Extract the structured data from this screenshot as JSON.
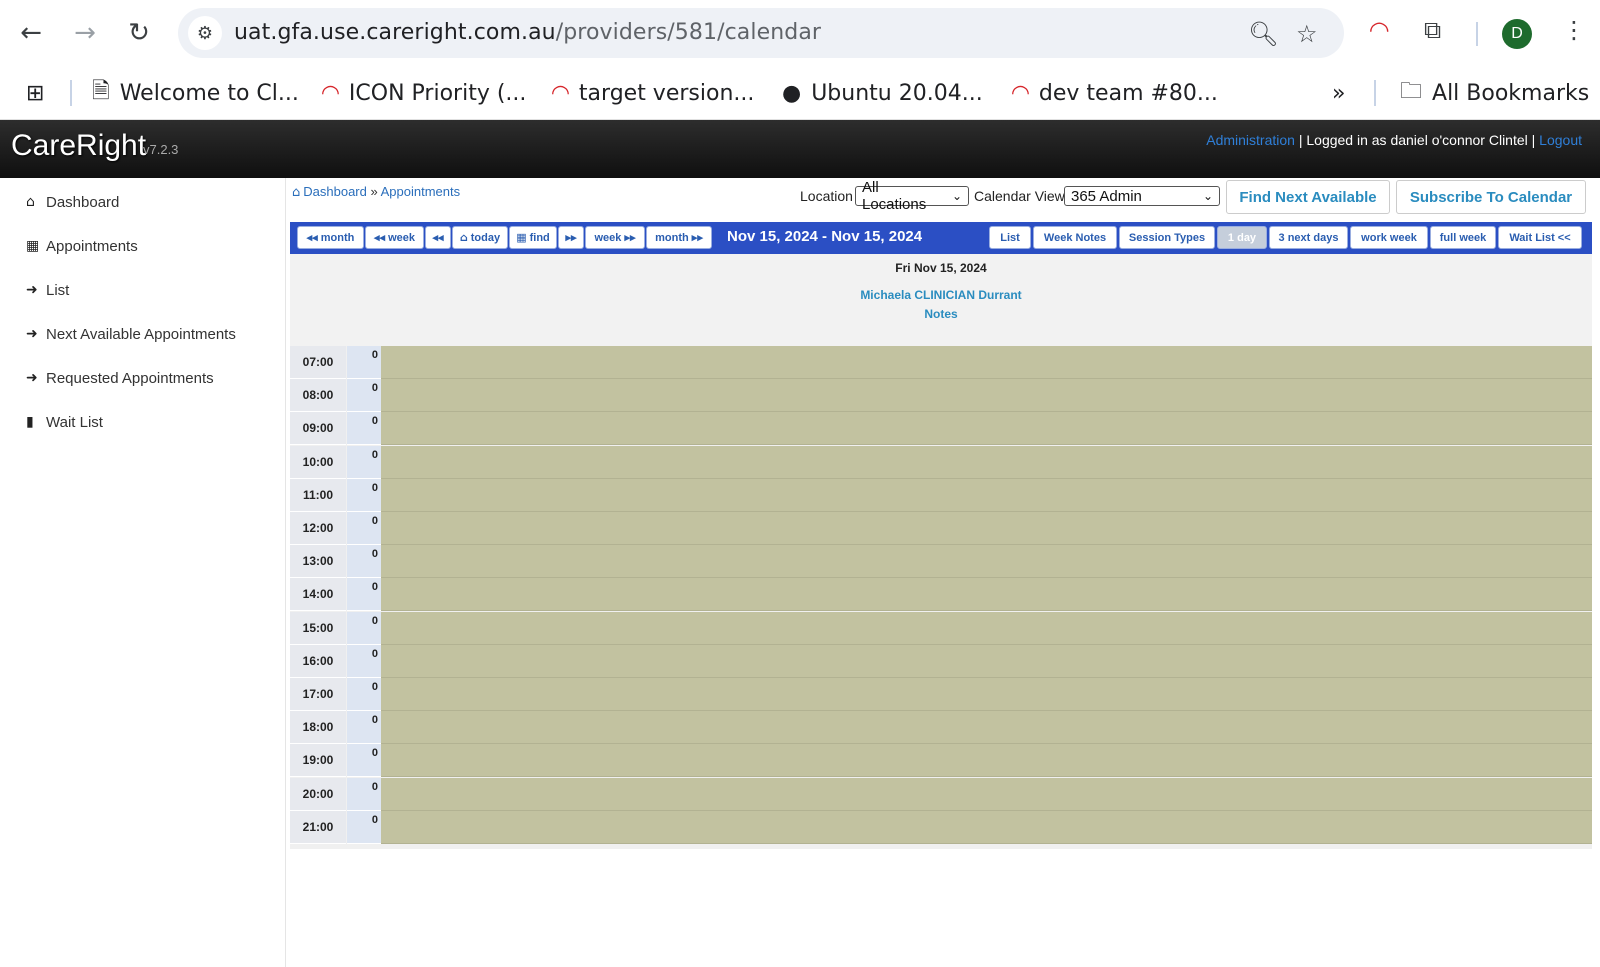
{
  "browser": {
    "url_host": "uat.gfa.use.careright.com.au",
    "url_path": "/providers/581/calendar",
    "avatar_letter": "D",
    "bookmarks": [
      {
        "label": "Welcome to Cl...",
        "icon": "document-icon"
      },
      {
        "label": "ICON Priority (...",
        "icon": "arc-logo-icon"
      },
      {
        "label": "target version...",
        "icon": "arc-logo-icon"
      },
      {
        "label": "Ubuntu 20.04...",
        "icon": "penguin-icon"
      },
      {
        "label": "dev team #80...",
        "icon": "arc-logo-icon"
      }
    ],
    "all_bookmarks_label": "All Bookmarks"
  },
  "app": {
    "brand": "CareRight",
    "version": "v7.2.3",
    "admin_link": "Administration",
    "logged_in_text": " | Logged in as daniel o'connor Clintel | ",
    "logout_link": "Logout"
  },
  "sidebar": {
    "items": [
      {
        "label": "Dashboard",
        "icon": "home-icon"
      },
      {
        "label": "Appointments",
        "icon": "calendar-icon"
      },
      {
        "label": "List",
        "icon": "chevron-circle-icon"
      },
      {
        "label": "Next Available Appointments",
        "icon": "chevron-circle-icon"
      },
      {
        "label": "Requested Appointments",
        "icon": "chevron-circle-icon"
      },
      {
        "label": "Wait List",
        "icon": "book-icon"
      }
    ]
  },
  "main": {
    "breadcrumb_dashboard": "Dashboard",
    "breadcrumb_sep": " » ",
    "breadcrumb_appointments": "Appointments",
    "location_label": "Location",
    "location_value": "All Locations",
    "calendar_view_label": "Calendar View",
    "calendar_view_value": "365 Admin",
    "find_next_label": "Find Next Available",
    "subscribe_label": "Subscribe To Calendar"
  },
  "calbar": {
    "nav": [
      "◂◂ month",
      "◂◂ week",
      "◂◂",
      "today",
      "find",
      "▸▸",
      "week ▸▸",
      "month ▸▸"
    ],
    "range": "Nov 15, 2024 - Nov 15, 2024",
    "views": [
      "List",
      "Week Notes",
      "Session Types",
      "1 day",
      "3 next days",
      "work week",
      "full week",
      "Wait List <<"
    ],
    "active_view": "1 day"
  },
  "day": {
    "date": "Fri Nov 15, 2024",
    "clinician": "Michaela CLINICIAN Durrant",
    "notes": "Notes"
  },
  "rows": [
    {
      "time": "07:00",
      "count": "0"
    },
    {
      "time": "08:00",
      "count": "0"
    },
    {
      "time": "09:00",
      "count": "0"
    },
    {
      "time": "10:00",
      "count": "0"
    },
    {
      "time": "11:00",
      "count": "0"
    },
    {
      "time": "12:00",
      "count": "0"
    },
    {
      "time": "13:00",
      "count": "0"
    },
    {
      "time": "14:00",
      "count": "0"
    },
    {
      "time": "15:00",
      "count": "0"
    },
    {
      "time": "16:00",
      "count": "0"
    },
    {
      "time": "17:00",
      "count": "0"
    },
    {
      "time": "18:00",
      "count": "0"
    },
    {
      "time": "19:00",
      "count": "0"
    },
    {
      "time": "20:00",
      "count": "0"
    },
    {
      "time": "21:00",
      "count": "0"
    }
  ],
  "colors": {
    "calbar": "#2b4fc4",
    "slot": "#c2c2a0",
    "link": "#2a8cbf"
  }
}
